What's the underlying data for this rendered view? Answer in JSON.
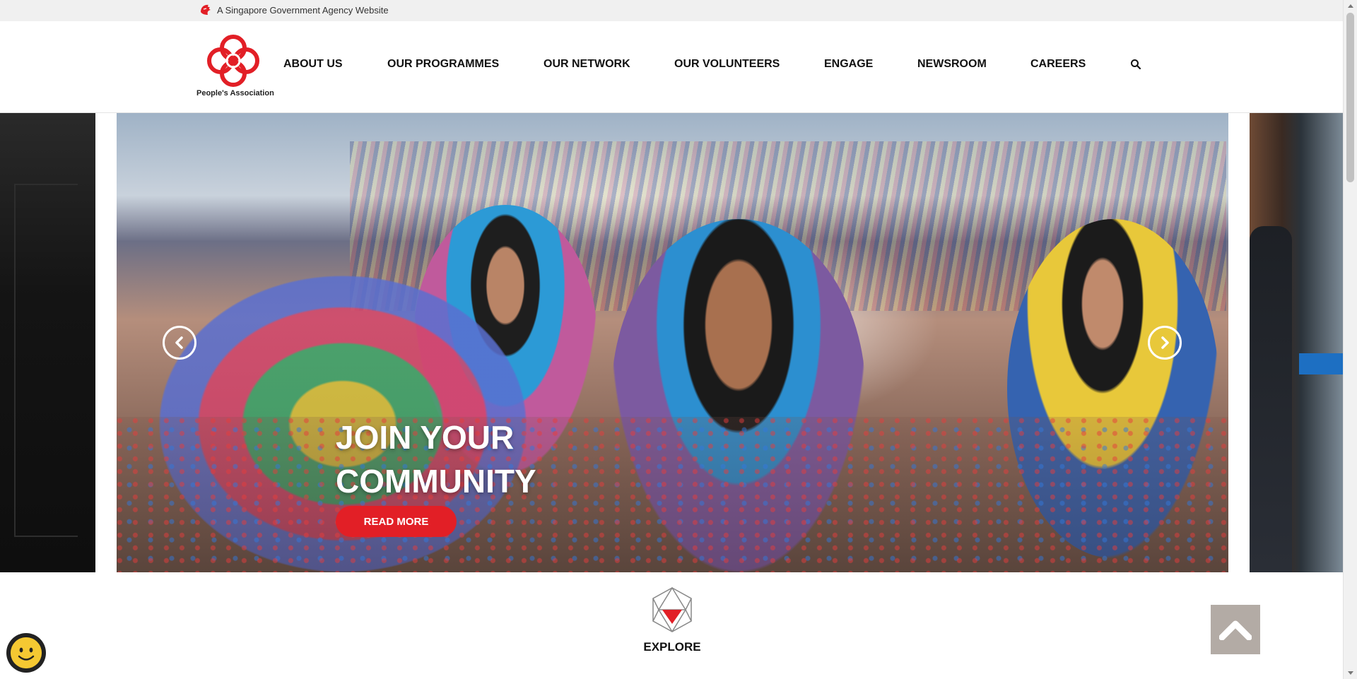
{
  "gov_bar": {
    "text": "A Singapore Government Agency Website",
    "icon": "lion-head-icon"
  },
  "header": {
    "logo_text": "People's Association",
    "nav": [
      {
        "label": "ABOUT US"
      },
      {
        "label": "OUR PROGRAMMES"
      },
      {
        "label": "OUR NETWORK"
      },
      {
        "label": "OUR VOLUNTEERS"
      },
      {
        "label": "ENGAGE"
      },
      {
        "label": "NEWSROOM"
      },
      {
        "label": "CAREERS"
      }
    ],
    "search_icon": "search-icon"
  },
  "carousel": {
    "slide_title_line1": "JOIN YOUR",
    "slide_title_line2": "COMMUNITY",
    "read_more_label": "READ MORE",
    "prev_icon": "chevron-left-icon",
    "next_icon": "chevron-right-icon"
  },
  "explore": {
    "label": "EXPLORE",
    "icon": "icosahedron-icon"
  },
  "back_to_top": {
    "icon": "chevron-up-icon"
  },
  "chat": {
    "icon": "smiley-face-icon"
  },
  "colors": {
    "brand_red": "#e21f26",
    "gov_bar_bg": "#f0f0f0",
    "back_to_top_bg": "#b3aba5"
  }
}
